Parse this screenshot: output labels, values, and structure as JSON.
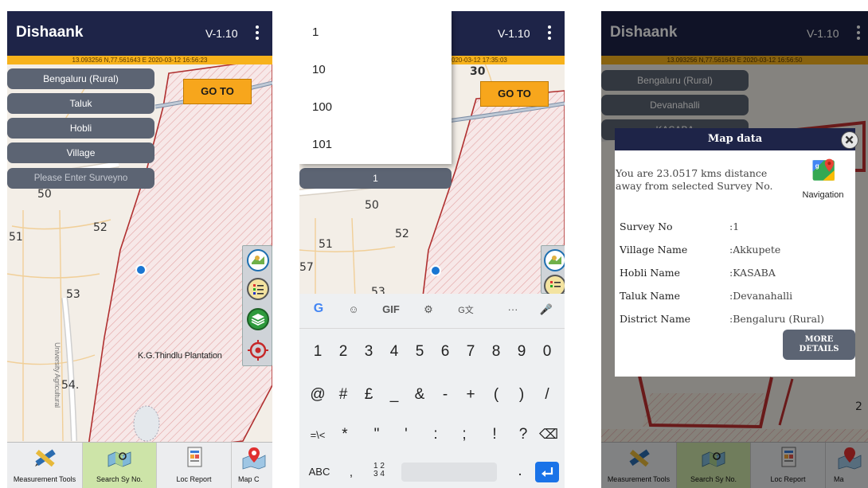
{
  "screen1": {
    "app_title": "Dishaank",
    "version": "V-1.10",
    "coord_status": "13.093256 N,77.561643 E  2020-03-12 16:56:23",
    "district": "Bengaluru (Rural)",
    "taluk": "Taluk",
    "hobli": "Hobli",
    "village": "Village",
    "survey_placeholder": "Please Enter Surveyno",
    "goto_label": "GO TO",
    "map_labels": [
      "50",
      "52",
      "51",
      "53",
      "54."
    ],
    "plantation_label": "K.G.Thindlu Plantation",
    "road_label": "University Agricultural"
  },
  "screen2": {
    "version": "V-1.10",
    "coord_status": "020-03-12 17:35:03",
    "goto_label": "GO TO",
    "dropdown_options": [
      "1",
      "10",
      "100",
      "101"
    ],
    "survey_value": "1",
    "map_labels": [
      "30",
      "50",
      "52",
      "51",
      "57",
      "53"
    ],
    "keyboard": {
      "suggestions": [
        "G",
        "☺",
        "GIF",
        "⚙",
        "G文",
        "···",
        "🎤"
      ],
      "row1": [
        "1",
        "2",
        "3",
        "4",
        "5",
        "6",
        "7",
        "8",
        "9",
        "0"
      ],
      "row2": [
        "@",
        "#",
        "£",
        "_",
        "&",
        "-",
        "+",
        "(",
        ")",
        "/"
      ],
      "row3": [
        "=\\<",
        "*",
        "\"",
        "'",
        ":",
        ";",
        "!",
        "?",
        "⌫"
      ],
      "abc": "ABC",
      "comma": ",",
      "fraction": "1 2 3 4",
      "period": "."
    }
  },
  "screen3": {
    "app_title": "Dishaank",
    "version": "V-1.10",
    "coord_status": "13.093256 N,77.561643 E  2020-03-12 16:56:50",
    "district": "Bengaluru (Rural)",
    "taluk": "Devanahalli",
    "hobli": "KASABA",
    "dialog": {
      "title": "Map data",
      "message": "You are 23.0517 kms distance away from selected Survey No.",
      "navigation_label": "Navigation",
      "rows": [
        {
          "label": "Survey No",
          "value": ":1"
        },
        {
          "label": "Village Name",
          "value": ":Akkupete"
        },
        {
          "label": "Hobli Name",
          "value": ":KASABA"
        },
        {
          "label": "Taluk Name",
          "value": ":Devanahalli"
        },
        {
          "label": "District Name",
          "value": ":Bengaluru (Rural)"
        }
      ],
      "more_line1": "MORE",
      "more_line2": "DETAILS"
    },
    "map_label": "2"
  },
  "bottom_nav": [
    "Measurement Tools",
    "Search Sy No.",
    "Loc Report",
    "Map C"
  ],
  "colors": {
    "app_bar": "#1e2448",
    "status_bar": "#f7b21c",
    "pill": "#5c6473",
    "goto": "#f7a61c",
    "active_tab": "#cde4a8",
    "boundary": "#b03030",
    "enter_key": "#1a73e8"
  },
  "icons": [
    "kebab-menu-icon",
    "map-layer-icon",
    "list-icon",
    "layers-icon",
    "target-icon",
    "pencil-ruler-icon",
    "map-search-icon",
    "report-icon",
    "map-pin-icon",
    "close-icon",
    "google-maps-icon",
    "enter-icon",
    "backspace-icon",
    "mic-icon"
  ]
}
